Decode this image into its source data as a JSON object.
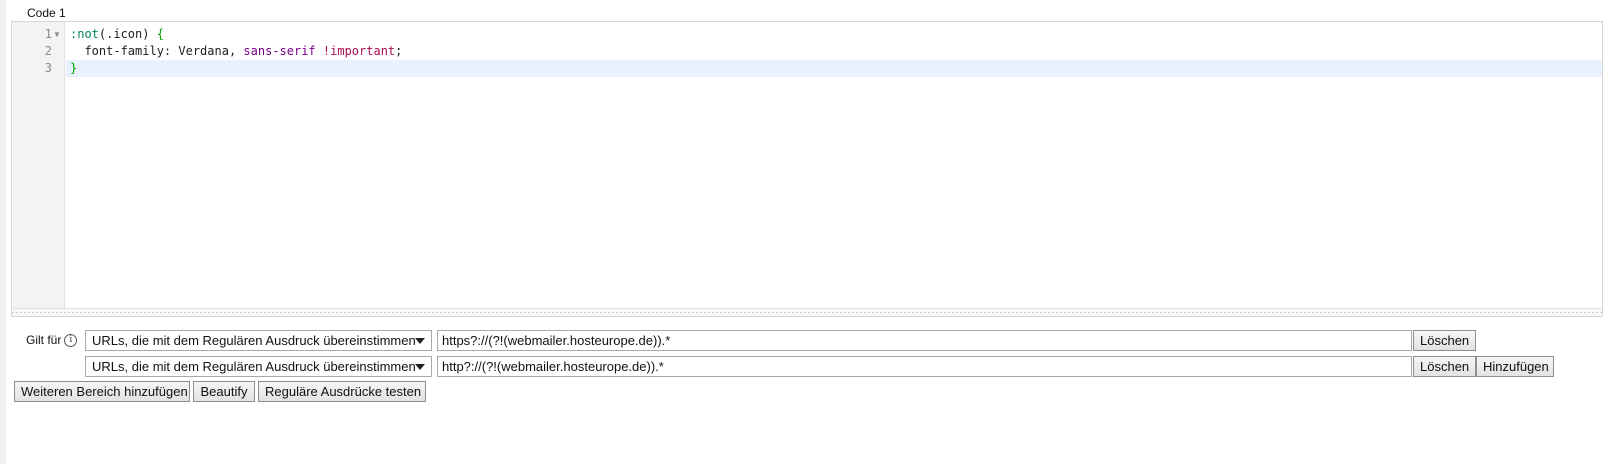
{
  "code_section": {
    "heading": "Code 1",
    "line_numbers": [
      "1",
      "2",
      "3"
    ],
    "fold_icon": "fold-triangle-icon",
    "lines": [
      [
        {
          "text": ":not",
          "cls": "tok-sel"
        },
        {
          "text": "(.icon) ",
          "cls": "tok-val"
        },
        {
          "text": "{",
          "cls": "tok-brace"
        }
      ],
      [
        {
          "text": "  font-family",
          "cls": "tok-val"
        },
        {
          "text": ": Verdana, ",
          "cls": "tok-val"
        },
        {
          "text": "sans-serif",
          "cls": "tok-kw"
        },
        {
          "text": " ",
          "cls": "tok-val"
        },
        {
          "text": "!important",
          "cls": "tok-imp"
        },
        {
          "text": ";",
          "cls": "tok-val"
        }
      ],
      [
        {
          "text": "}",
          "cls": "tok-brace"
        }
      ]
    ],
    "active_line": 3
  },
  "applies_to": {
    "label": "Gilt für",
    "info_icon": "info-icon",
    "info_glyph": "i",
    "rules": [
      {
        "type": "URLs, die mit dem Regulären Ausdruck übereinstimmen",
        "value": "https?://(?!(webmailer.hosteurope.de)).*",
        "delete_label": "Löschen"
      },
      {
        "type": "URLs, die mit dem Regulären Ausdruck übereinstimmen",
        "value": "http?://(?!(webmailer.hosteurope.de)).*",
        "delete_label": "Löschen",
        "add_label": "Hinzufügen"
      }
    ]
  },
  "actions": {
    "add_section": "Weiteren Bereich hinzufügen",
    "beautify": "Beautify",
    "test_regex": "Reguläre Ausdrücke testen"
  }
}
